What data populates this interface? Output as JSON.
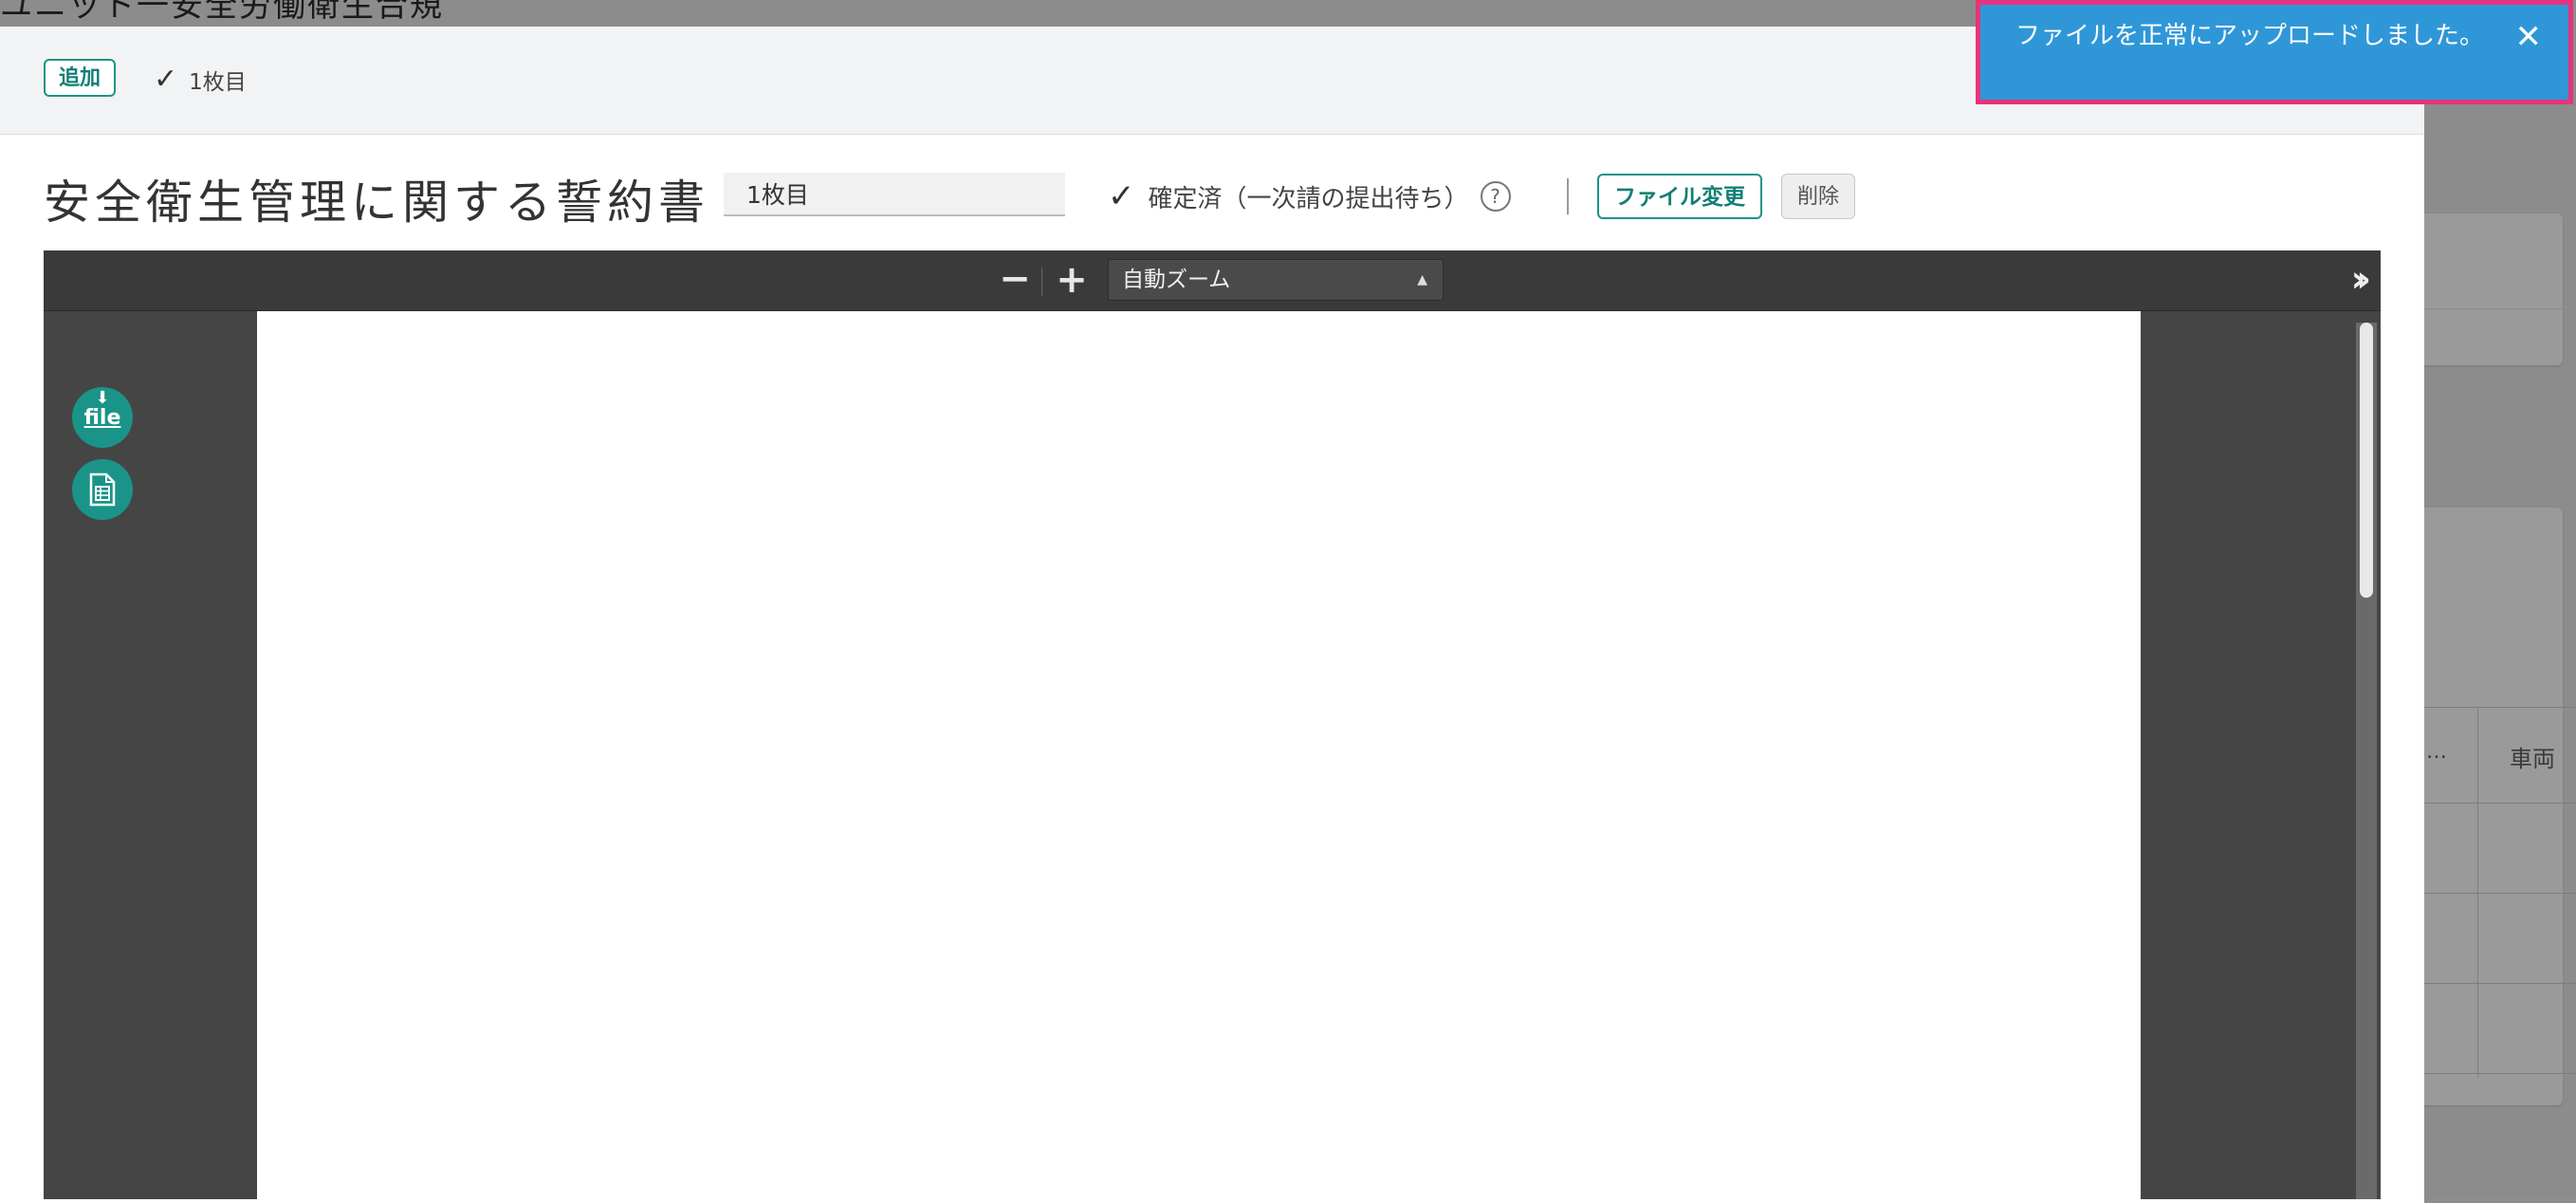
{
  "background": {
    "partial_title": "ユニット一安全労働衛生合規",
    "table_header_a": "…",
    "table_header_b": "車両"
  },
  "modal": {
    "header": {
      "add_label": "追加",
      "page_tab_label": "1枚目"
    },
    "document": {
      "title": "安全衛生管理に関する誓約書",
      "page_name_value": "1枚目",
      "status_text": "確定済（一次請の提出待ち）",
      "help_icon": "question-circle-icon",
      "file_change_label": "ファイル変更",
      "delete_label": "削除"
    },
    "pdf_viewer": {
      "zoom_out_symbol": "−",
      "zoom_in_symbol": "+",
      "zoom_selected": "自動ズーム",
      "sidebar_toggle_symbol": "»",
      "download_label": "file"
    }
  },
  "toast": {
    "message": "ファイルを正常にアップロードしました。",
    "close_symbol": "✕"
  },
  "colors": {
    "accent": "#1a9488",
    "toast_bg": "#2f97d8",
    "toast_border": "#e8337c"
  }
}
